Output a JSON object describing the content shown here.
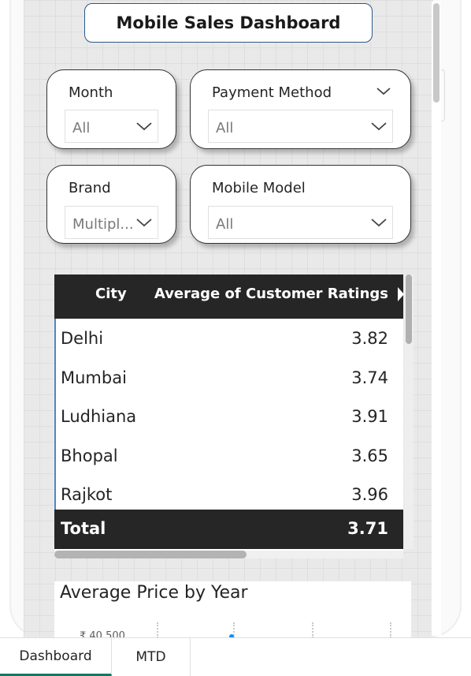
{
  "dashboard_title": "Mobile Sales Dashboard",
  "slicers": [
    {
      "label": "Month",
      "value": "All"
    },
    {
      "label": "Payment Method",
      "value": "All"
    },
    {
      "label": "Brand",
      "value": "Multipl..."
    },
    {
      "label": "Mobile Model",
      "value": "All"
    }
  ],
  "table": {
    "columns": [
      "City",
      "Average of Customer Ratings"
    ],
    "rows": [
      {
        "city": "Delhi",
        "value": "3.82"
      },
      {
        "city": "Mumbai",
        "value": "3.74"
      },
      {
        "city": "Ludhiana",
        "value": "3.91"
      },
      {
        "city": "Bhopal",
        "value": "3.65"
      },
      {
        "city": "Rajkot",
        "value": "3.96"
      }
    ],
    "total_label": "Total",
    "total_value": "3.71"
  },
  "chart": {
    "title": "Average Price by Year",
    "y_tick": "₹ 40,500"
  },
  "tabs": [
    {
      "label": "Dashboard",
      "active": true
    },
    {
      "label": "MTD",
      "active": false
    }
  ],
  "colors": {
    "header_bg": "#262626",
    "accent": "#117865",
    "title_border": "#2b5a86",
    "selection_accent": "#4c87c4",
    "series_color": "#118dff"
  }
}
